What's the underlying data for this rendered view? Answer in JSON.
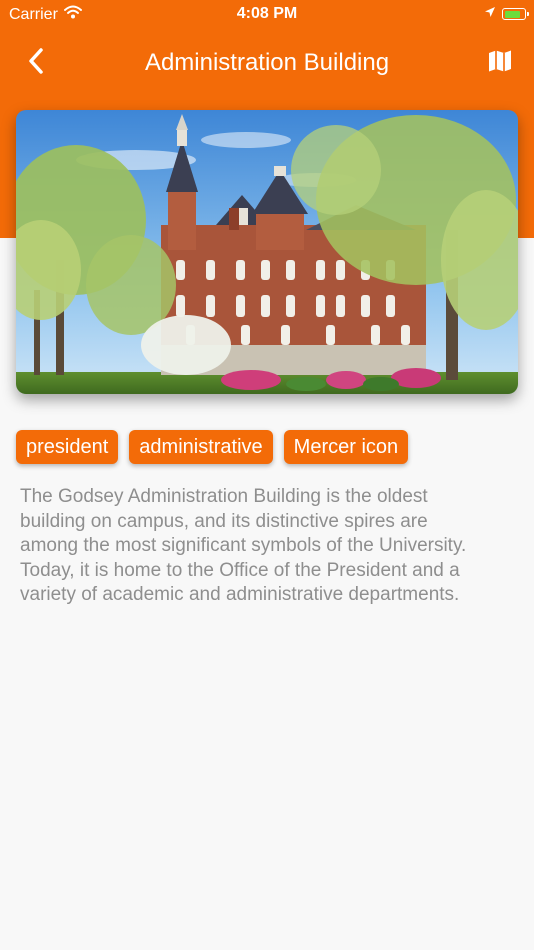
{
  "status_bar": {
    "carrier": "Carrier",
    "time": "4:08 PM",
    "battery_level": 0.85,
    "battery_color": "#6bdc3d"
  },
  "nav": {
    "title": "Administration Building",
    "back_icon": "chevron-left-icon",
    "map_icon": "map-icon"
  },
  "hero_image": {
    "subject": "photo"
  },
  "tags": [
    {
      "label": "president"
    },
    {
      "label": "administrative"
    },
    {
      "label": "Mercer icon"
    }
  ],
  "description": "The Godsey Administration Building is the oldest building on campus, and its distinctive spires are among the most significant symbols of the University. Today, it is home to the Office of the President and a variety of academic and administrative departments.",
  "colors": {
    "accent": "#f36b08",
    "background": "#f8f8f8",
    "description_text": "#8e8e8e"
  }
}
